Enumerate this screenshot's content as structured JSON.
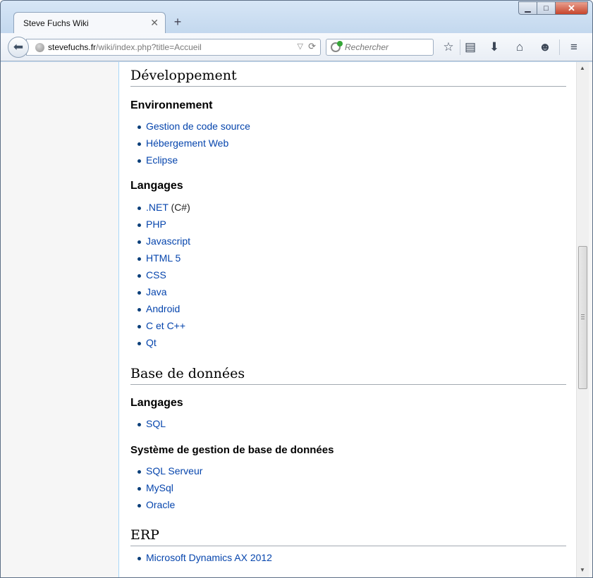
{
  "browser": {
    "tab_title": "Steve Fuchs Wiki",
    "new_tab_symbol": "+",
    "close_tab_symbol": "✕",
    "url_domain": "stevefuchs.fr",
    "url_path": "/wiki/index.php?title=Accueil",
    "search_placeholder": "Rechercher",
    "window_buttons": {
      "minimize": "▁",
      "maximize": "□",
      "close": "✕"
    }
  },
  "toolbar_icons": [
    "star-icon",
    "reading-list-icon",
    "download-icon",
    "home-icon",
    "hello-icon",
    "menu-icon"
  ],
  "wiki": {
    "section_dev": {
      "title": "Développement",
      "sub_env": {
        "title": "Environnement",
        "items": [
          "Gestion de code source",
          "Hébergement Web",
          "Eclipse"
        ]
      },
      "sub_lang": {
        "title": "Langages",
        "net_link": ".NET",
        "net_suffix": " (C#)",
        "items": [
          "PHP",
          "Javascript",
          "HTML 5",
          "CSS",
          "Java",
          "Android",
          "C et C++",
          "Qt"
        ]
      }
    },
    "section_db": {
      "title": "Base de données",
      "sub_lang": {
        "title": "Langages",
        "items": [
          "SQL"
        ]
      },
      "sub_sgbd": {
        "title": "Système de gestion de base de données",
        "items": [
          "SQL Serveur",
          "MySql",
          "Oracle"
        ]
      }
    },
    "section_erp": {
      "title": "ERP",
      "items": [
        "Microsoft Dynamics AX 2012"
      ]
    }
  },
  "colors": {
    "link": "#0645ad",
    "bullet": "#0b3f7a",
    "page_border": "#a7d7f9"
  }
}
